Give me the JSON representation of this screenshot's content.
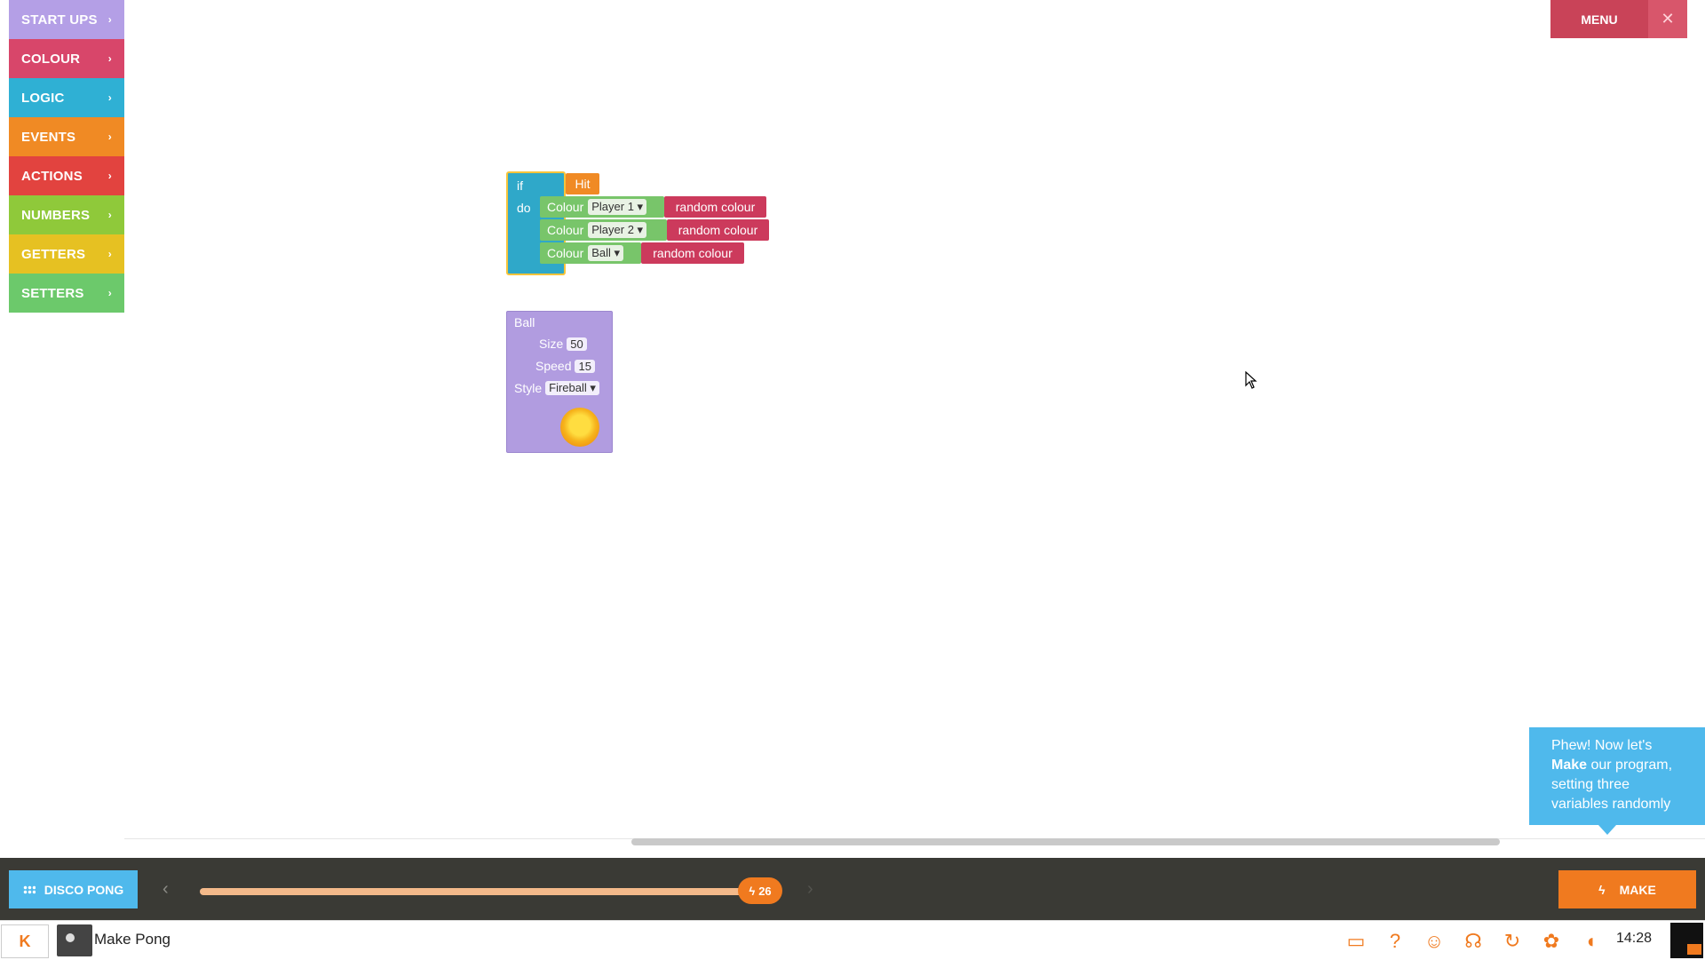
{
  "palette": {
    "categories": [
      {
        "label": "START UPS",
        "color": "#b49fe6"
      },
      {
        "label": "COLOUR",
        "color": "#d8466a"
      },
      {
        "label": "LOGIC",
        "color": "#2fb0d4"
      },
      {
        "label": "EVENTS",
        "color": "#f08a24"
      },
      {
        "label": "ACTIONS",
        "color": "#e2433f"
      },
      {
        "label": "NUMBERS",
        "color": "#8fc93a"
      },
      {
        "label": "GETTERS",
        "color": "#e6c122"
      },
      {
        "label": "SETTERS",
        "color": "#6cc96b"
      }
    ]
  },
  "header": {
    "menu_label": "MENU",
    "close_symbol": "✕"
  },
  "workspace": {
    "if_block": {
      "if_label": "if",
      "do_label": "do",
      "condition": "Hit",
      "rows": [
        {
          "label": "Colour",
          "target": "Player 1 ▾",
          "value": "random colour"
        },
        {
          "label": "Colour",
          "target": "Player 2 ▾",
          "value": "random colour"
        },
        {
          "label": "Colour",
          "target": "Ball ▾",
          "value": "random colour"
        }
      ]
    },
    "ball_block": {
      "title": "Ball",
      "size_label": "Size",
      "size_value": "50",
      "speed_label": "Speed",
      "speed_value": "15",
      "style_label": "Style",
      "style_value": "Fireball ▾"
    }
  },
  "tooltip": {
    "line1": "Phew! Now let's",
    "bold": "Make",
    "line2": " our program, setting three variables randomly"
  },
  "bottombar": {
    "project_label": "DISCO PONG",
    "step": "26",
    "progress_fraction": 0.92,
    "make_label": "MAKE"
  },
  "taskbar": {
    "launcher_label": "K",
    "app_title": "Make Pong",
    "clock": "14:28",
    "tray_icons": [
      "display-icon",
      "help-icon",
      "people-icon",
      "headset-icon",
      "refresh-icon",
      "settings-icon",
      "volume-icon"
    ]
  },
  "colors": {
    "logic_block": "#2fa8c9",
    "colour_setter": "#78c56a",
    "random_colour": "#cc3a5c",
    "condition": "#f08a24",
    "startup_block": "#b19ce0",
    "accent_orange": "#f07a1f",
    "tooltip_blue": "#4fb9ec"
  }
}
